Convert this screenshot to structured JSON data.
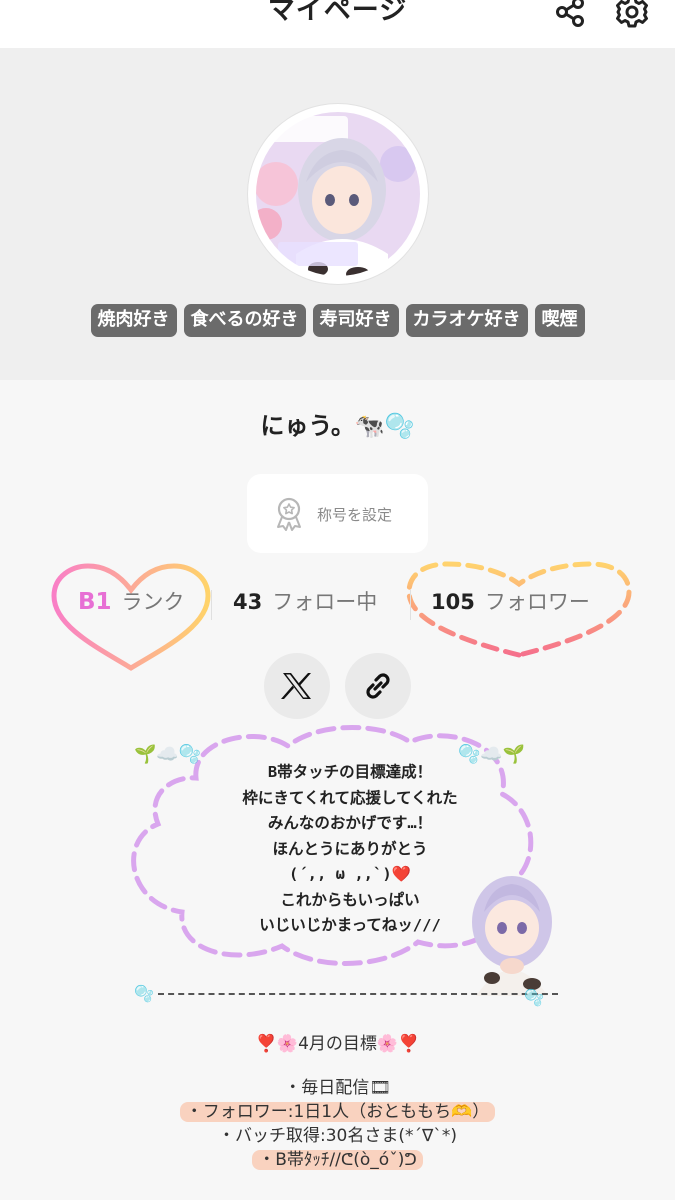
{
  "header": {
    "title": "マイページ"
  },
  "profile": {
    "tags": [
      "焼肉好き",
      "食べるの好き",
      "寿司好き",
      "カラオケ好き",
      "喫煙"
    ],
    "name": "にゅう。🐄🫧",
    "title_button_label": "称号を設定",
    "rank": {
      "value": "B1",
      "label": "ランク"
    },
    "following": {
      "count": "43",
      "label": "フォロー中"
    },
    "followers": {
      "count": "105",
      "label": "フォロワー"
    }
  },
  "bio": {
    "lines": [
      "B帯タッチの目標達成！",
      "枠にきてくれて応援してくれた",
      "みんなのおかげです…！",
      "ほんとうにありがとう",
      "(´,, ω ,,`)❤️",
      "これからもいっぱい",
      "いじいじかまってねッ///"
    ],
    "sprout_left": "🌱☁️🫧",
    "sprout_right": "🫧☁️🌱",
    "bubble_mark": "🫧"
  },
  "goals": {
    "title": "❣️🌸4月の目標🌸❣️",
    "items": [
      "・毎日配信🎞",
      "・フォロワー:1日1人（おとももち🫶）",
      "・バッチ取得:30名さま(*´∇`*)",
      "・B帯ﾀｯﾁ//ᕦ(ò_óˇ)ᕤ"
    ]
  },
  "colors": {
    "rank_heart": "#f98ab8",
    "rank_text": "#e76fd4",
    "followers_heart_top": "#ffd36e",
    "followers_heart_bottom": "#f5708c",
    "cloud_dash": "#d9a6ee",
    "tag_bg": "#6b6b6b",
    "goal_highlight": "#f9d2bf"
  },
  "icons": [
    "share-icon",
    "gear-icon",
    "medal-icon",
    "x-logo-icon",
    "link-icon"
  ]
}
